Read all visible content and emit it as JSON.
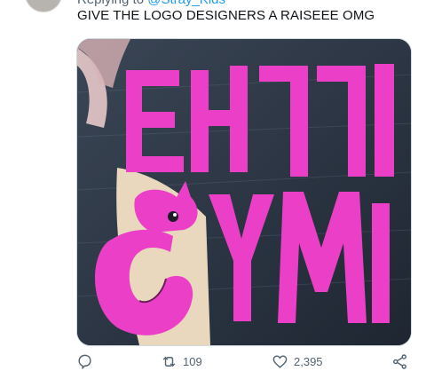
{
  "reply": {
    "prefix": "Replying to",
    "handle": "@Stray_Kids"
  },
  "tweet": {
    "text": "GIVE THE LOGO DESIGNERS A RAISEEE OMG"
  },
  "media": {
    "sign_line1": "EH7I",
    "sign_line2": "GYM",
    "sign_color": "#ec3fc7",
    "alt": "pink gym logo sign"
  },
  "actions": {
    "reply_icon": "reply-icon",
    "retweet_icon": "retweet-icon",
    "retweet_count": "109",
    "like_icon": "heart-icon",
    "like_count": "2,395",
    "share_icon": "share-icon"
  },
  "colors": {
    "accent": "#1d9bf0",
    "muted": "#536471",
    "text": "#0f1419"
  }
}
